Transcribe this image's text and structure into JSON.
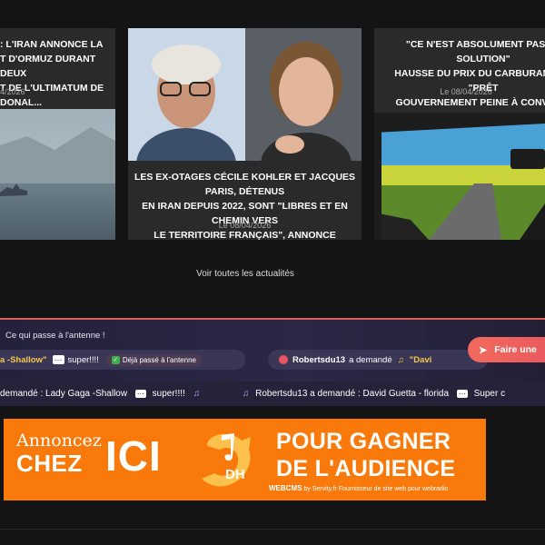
{
  "news": [
    {
      "title": ": L'IRAN ANNONCE LA\nT D'ORMUZ DURANT DEUX\nT DE L'ULTIMATUM DE DONAL...",
      "date": "4/2026"
    },
    {
      "title": "LES EX-OTAGES CÉCILE KOHLER ET JACQUES PARIS, DÉTENUS\nEN IRAN DEPUIS 2022, SONT \"LIBRES ET EN CHEMIN VERS\nLE TERRITOIRE FRANÇAIS\", ANNONCE EMMANUEL MACRON",
      "date": "Le 08/04/2026"
    },
    {
      "title": "\"CE N'EST ABSOLUMENT PAS LA SOLUTION\"\nHAUSSE DU PRIX DU CARBURANT, LE \"PRÊT\nGOUVERNEMENT PEINE À CONVAINC",
      "date": "Le 08/04/2026"
    }
  ],
  "see_all": "Voir toutes les actualités",
  "antenna": {
    "label": "Ce qui passe à l'antenne !",
    "request1": {
      "song": "a -Shallow\"",
      "message": "super!!!!",
      "badge": "Déjà passé à l'antenne"
    },
    "request2": {
      "user": "Robertsdu13",
      "verb": "a demandé",
      "song": "\"Davi"
    },
    "cta": "Faire une"
  },
  "ticker": {
    "item1": "demandé : Lady Gaga -Shallow",
    "msg1": "super!!!!",
    "item2": "Robertsdu13 a demandé : David Guetta - florida",
    "msg2": "Super c"
  },
  "banner": {
    "annoncez": "Annoncez",
    "chez": "CHEZ",
    "ici": "ICI",
    "line1": "POUR GAGNER",
    "line2": "DE L'AUDIENCE",
    "logo_letters": "DH",
    "footer_brand": "WEBCMS",
    "footer_text": "by Servity.fr Fournisseur de site web pour webradio"
  },
  "colors": {
    "accent": "#e8555e",
    "banner": "#f97a0a",
    "highlight": "#f5c84c"
  }
}
